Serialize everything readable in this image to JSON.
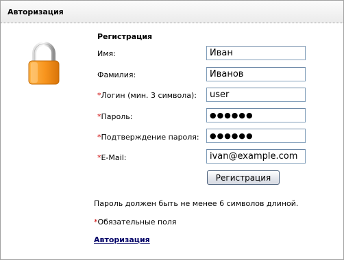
{
  "window": {
    "title": "Авторизация"
  },
  "lock_icon": {
    "name": "padlock-icon",
    "color_body": "#f59a1d",
    "color_shackle": "#b5b5b5"
  },
  "form": {
    "title": "Регистрация",
    "required_marker": "*",
    "fields": [
      {
        "label": "Имя:",
        "required": false,
        "value": "Иван",
        "type": "text"
      },
      {
        "label": "Фамилия:",
        "required": false,
        "value": "Иванов",
        "type": "text"
      },
      {
        "label": "Логин (мин. 3 символа):",
        "required": true,
        "value": "user",
        "type": "text"
      },
      {
        "label": "Пароль:",
        "required": true,
        "value": "●●●●●●",
        "type": "password"
      },
      {
        "label": "Подтверждение пароля:",
        "required": true,
        "value": "●●●●●●",
        "type": "password"
      },
      {
        "label": "E-Mail:",
        "required": true,
        "value": "ivan@example.com",
        "type": "text"
      }
    ],
    "submit_label": "Регистрация"
  },
  "notes": {
    "password_hint": "Пароль должен быть не менее 6 символов длиной.",
    "required_hint": "Обязательные поля"
  },
  "login_link": "Авторизация",
  "colors": {
    "required": "#cc0000",
    "link": "#000066",
    "field_border": "#7f9db9"
  }
}
